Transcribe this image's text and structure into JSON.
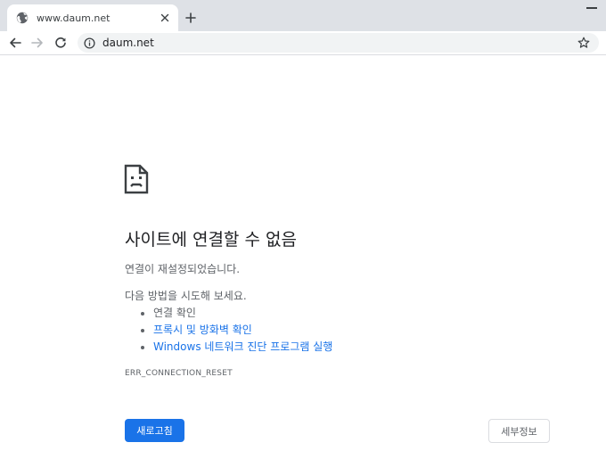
{
  "browser": {
    "tab": {
      "title": "www.daum.net",
      "favicon": "globe-icon",
      "close_icon": "close-icon"
    },
    "new_tab_icon": "plus-icon",
    "window_controls": {
      "minimize_icon": "minimize-icon"
    },
    "toolbar": {
      "back_icon": "back-arrow-icon",
      "forward_icon": "forward-arrow-icon",
      "reload_icon": "reload-icon",
      "omnibox": {
        "info_icon": "info-icon",
        "url": "daum.net",
        "bookmark_icon": "star-icon"
      }
    }
  },
  "error_page": {
    "icon": "sad-page-icon",
    "title": "사이트에 연결할 수 없음",
    "message": "연결이 재설정되었습니다.",
    "try_intro": "다음 방법을 시도해 보세요.",
    "suggestions": [
      {
        "label": "연결 확인",
        "is_link": false
      },
      {
        "label": "프록시 및 방화벽 확인",
        "is_link": true
      },
      {
        "label": "Windows 네트워크 진단 프로그램 실행",
        "is_link": true
      }
    ],
    "error_code": "ERR_CONNECTION_RESET",
    "reload_button": "새로고침",
    "details_button": "세부정보"
  },
  "colors": {
    "accent": "#1a73e8",
    "text_primary": "#202124",
    "text_secondary": "#5f6368",
    "tabstrip_bg": "#dee1e6",
    "omnibox_bg": "#f1f3f4"
  }
}
